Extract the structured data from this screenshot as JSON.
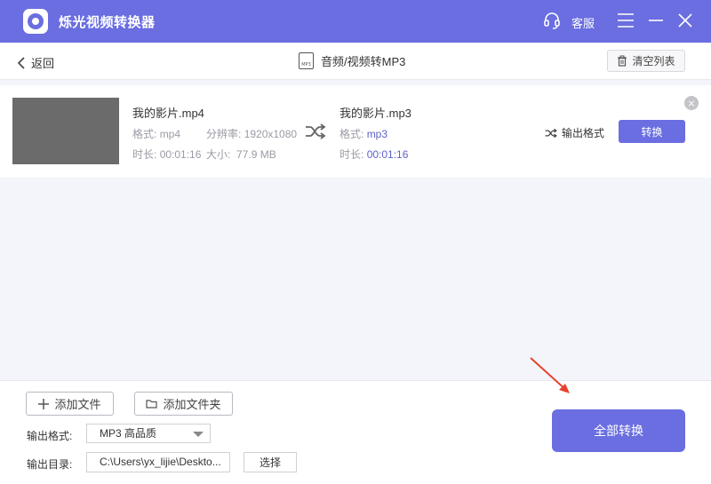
{
  "app": {
    "title": "烁光视频转换器",
    "service_label": "客服"
  },
  "toolbar": {
    "back_label": "返回",
    "page_title": "音频/视频转MP3",
    "clear_label": "清空列表"
  },
  "file": {
    "source": {
      "name": "我的影片.mp4",
      "format_label": "格式:",
      "format": "mp4",
      "resolution_label": "分辨率:",
      "resolution": "1920x1080",
      "duration_label": "时长:",
      "duration": "00:01:16",
      "size_label": "大小:",
      "size": "77.9 MB"
    },
    "target": {
      "name": "我的影片.mp3",
      "format_label": "格式:",
      "format": "mp3",
      "duration_label": "时长:",
      "duration": "00:01:16"
    },
    "output_format_label": "输出格式",
    "convert_label": "转换"
  },
  "bottom": {
    "add_file_label": "添加文件",
    "add_folder_label": "添加文件夹",
    "output_format_label": "输出格式:",
    "output_format_value": "MP3 高品质",
    "output_dir_label": "输出目录:",
    "output_dir_value": "C:\\Users\\yx_lijie\\Deskto...",
    "choose_label": "选择",
    "convert_all_label": "全部转换"
  },
  "colors": {
    "accent": "#6a6ee0",
    "annotation_arrow": "#e8412c"
  }
}
